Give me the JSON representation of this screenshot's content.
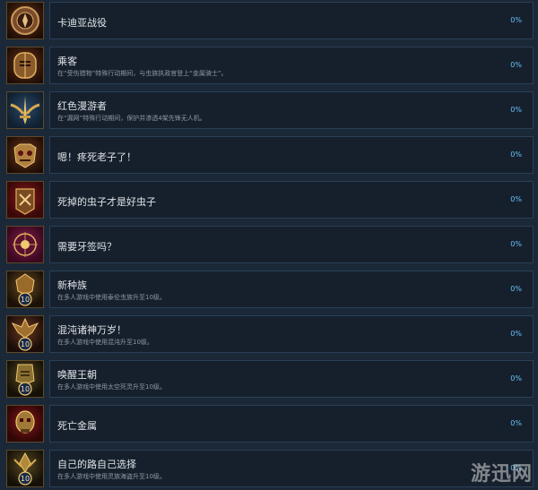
{
  "achievements": [
    {
      "title": "卡迪亚战役",
      "desc": "",
      "percent": "0%",
      "icon": "cadia-emblem-icon"
    },
    {
      "title": "乘客",
      "desc": "在“受伤猎物”特殊行动期间，与虫族执政官登上“金属骑士”。",
      "percent": "0%",
      "icon": "helmet-knight-icon"
    },
    {
      "title": "红色漫游者",
      "desc": "在“漏网”特殊行动期间，保护并渗透4架先锋无人机。",
      "percent": "0%",
      "icon": "winged-sword-icon"
    },
    {
      "title": "嗯！疼死老子了！",
      "desc": "",
      "percent": "0%",
      "icon": "ork-skull-icon"
    },
    {
      "title": "死掉的虫子才是好虫子",
      "desc": "",
      "percent": "0%",
      "icon": "bug-claw-icon"
    },
    {
      "title": "需要牙签吗？",
      "desc": "",
      "percent": "0%",
      "icon": "toothpick-emblem-icon"
    },
    {
      "title": "新种族",
      "desc": "在多人游戏中使用泰伦虫族升至10级。",
      "percent": "0%",
      "icon": "tyranid-level10-icon",
      "badge": "10"
    },
    {
      "title": "混沌诸神万岁！",
      "desc": "在多人游戏中使用混沌升至10级。",
      "percent": "0%",
      "icon": "chaos-level10-icon",
      "badge": "10"
    },
    {
      "title": "唤醒王朝",
      "desc": "在多人游戏中使用太空死灵升至10级。",
      "percent": "0%",
      "icon": "necron-level10-icon",
      "badge": "10"
    },
    {
      "title": "死亡金属",
      "desc": "",
      "percent": "0%",
      "icon": "necron-skull-icon"
    },
    {
      "title": "自己的路自己选择",
      "desc": "在多人游戏中使用灵族海盗升至10级。",
      "percent": "0%",
      "icon": "eldar-level10-icon",
      "badge": "10"
    }
  ],
  "watermark": "游迅网",
  "colors": {
    "background": "#1b2838",
    "panel": "#16202d",
    "percent": "#66c0f4",
    "title": "#dfe3e6",
    "desc": "#8f98a0"
  }
}
